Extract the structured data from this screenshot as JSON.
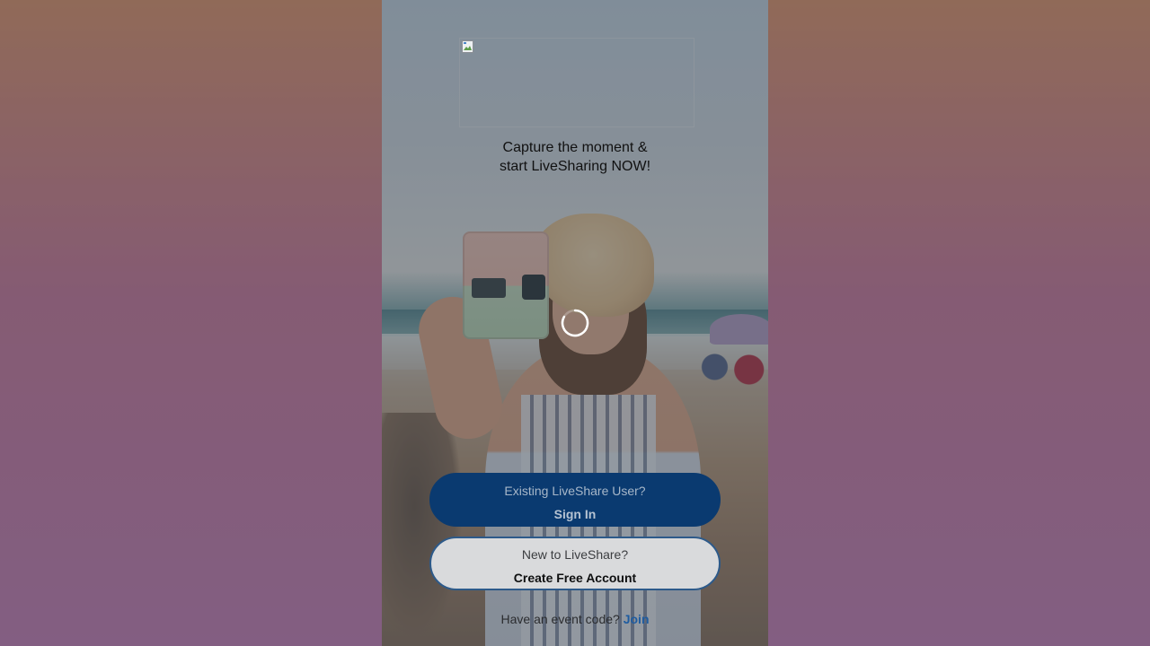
{
  "tagline": {
    "line1": "Capture the moment &",
    "line2": "start LiveSharing NOW!"
  },
  "logo": {
    "alt_icon": "broken-image-icon"
  },
  "loading": {
    "icon": "spinner-icon"
  },
  "signin_button": {
    "prompt": "Existing LiveShare User?",
    "label": "Sign In"
  },
  "create_button": {
    "prompt": "New to LiveShare?",
    "label": "Create Free Account"
  },
  "event_code": {
    "prompt": "Have an event code?",
    "link": "Join"
  },
  "colors": {
    "primary_button": "#0a3a70",
    "secondary_button": "#d9dadc",
    "link": "#1f5ca0"
  }
}
